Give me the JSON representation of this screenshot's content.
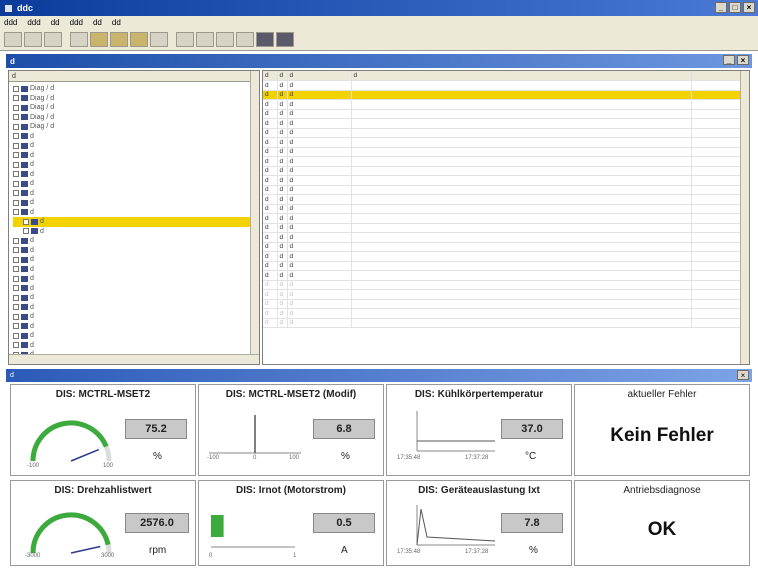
{
  "window": {
    "title": "ddc"
  },
  "menu": [
    "ddd",
    "ddd",
    "dd",
    "ddd",
    "dd",
    "dd"
  ],
  "inner": {
    "title": "d"
  },
  "tree": {
    "header": "d",
    "items": [
      {
        "label": "Diag / d",
        "sel": false
      },
      {
        "label": "Diag / d",
        "sel": false
      },
      {
        "label": "Diag / d",
        "sel": false
      },
      {
        "label": "Diag / d",
        "sel": false
      },
      {
        "label": "Diag / d",
        "sel": false
      },
      {
        "label": "d",
        "sel": false
      },
      {
        "label": "d",
        "sel": false
      },
      {
        "label": "d",
        "sel": false
      },
      {
        "label": "d",
        "sel": false
      },
      {
        "label": "d",
        "sel": false
      },
      {
        "label": "d",
        "sel": false
      },
      {
        "label": "d",
        "sel": false
      },
      {
        "label": "d",
        "sel": false
      },
      {
        "label": "d",
        "sel": false
      },
      {
        "label": "d",
        "sel": true
      },
      {
        "label": "d",
        "sel": false
      },
      {
        "label": "d",
        "sel": false
      },
      {
        "label": "d",
        "sel": false
      },
      {
        "label": "d",
        "sel": false
      },
      {
        "label": "d",
        "sel": false
      },
      {
        "label": "d",
        "sel": false
      },
      {
        "label": "d",
        "sel": false
      },
      {
        "label": "d",
        "sel": false
      },
      {
        "label": "d",
        "sel": false
      },
      {
        "label": "d",
        "sel": false
      },
      {
        "label": "d",
        "sel": false
      },
      {
        "label": "d",
        "sel": false
      },
      {
        "label": "d",
        "sel": false
      },
      {
        "label": "d",
        "sel": false
      }
    ]
  },
  "table": {
    "headers": [
      "d",
      "d",
      "d",
      "d"
    ],
    "rows": [
      {
        "a": "d",
        "b": "d",
        "name": "d",
        "val": "d",
        "sel": false,
        "faded": false
      },
      {
        "a": "d",
        "b": "d",
        "name": "d",
        "val": "d",
        "sel": true,
        "faded": false
      },
      {
        "a": "d",
        "b": "d",
        "name": "d",
        "val": "d",
        "sel": false,
        "faded": false
      },
      {
        "a": "d",
        "b": "d",
        "name": "d",
        "val": "d",
        "sel": false,
        "faded": false
      },
      {
        "a": "d",
        "b": "d",
        "name": "d",
        "val": "d",
        "sel": false,
        "faded": false
      },
      {
        "a": "d",
        "b": "d",
        "name": "d",
        "val": "d",
        "sel": false,
        "faded": false
      },
      {
        "a": "d",
        "b": "d",
        "name": "d",
        "val": "d",
        "sel": false,
        "faded": false
      },
      {
        "a": "d",
        "b": "d",
        "name": "d",
        "val": "d",
        "sel": false,
        "faded": false
      },
      {
        "a": "d",
        "b": "d",
        "name": "d",
        "val": "d",
        "sel": false,
        "faded": false
      },
      {
        "a": "d",
        "b": "d",
        "name": "d",
        "val": "d",
        "sel": false,
        "faded": false
      },
      {
        "a": "d",
        "b": "d",
        "name": "d",
        "val": "d",
        "sel": false,
        "faded": false
      },
      {
        "a": "d",
        "b": "d",
        "name": "d",
        "val": "d",
        "sel": false,
        "faded": false
      },
      {
        "a": "d",
        "b": "d",
        "name": "d",
        "val": "d",
        "sel": false,
        "faded": false
      },
      {
        "a": "d",
        "b": "d",
        "name": "d",
        "val": "d",
        "sel": false,
        "faded": false
      },
      {
        "a": "d",
        "b": "d",
        "name": "d",
        "val": "d",
        "sel": false,
        "faded": false
      },
      {
        "a": "d",
        "b": "d",
        "name": "d",
        "val": "d",
        "sel": false,
        "faded": false
      },
      {
        "a": "d",
        "b": "d",
        "name": "d",
        "val": "d",
        "sel": false,
        "faded": false
      },
      {
        "a": "d",
        "b": "d",
        "name": "d",
        "val": "d",
        "sel": false,
        "faded": false
      },
      {
        "a": "d",
        "b": "d",
        "name": "d",
        "val": "d",
        "sel": false,
        "faded": false
      },
      {
        "a": "d",
        "b": "d",
        "name": "d",
        "val": "d",
        "sel": false,
        "faded": false
      },
      {
        "a": "d",
        "b": "d",
        "name": "d",
        "val": "d",
        "sel": false,
        "faded": false
      },
      {
        "a": "d",
        "b": "d",
        "name": "d",
        "val": "d",
        "sel": false,
        "faded": true
      },
      {
        "a": "d",
        "b": "d",
        "name": "d",
        "val": "d",
        "sel": false,
        "faded": true
      },
      {
        "a": "d",
        "b": "d",
        "name": "d",
        "val": "d",
        "sel": false,
        "faded": true
      },
      {
        "a": "d",
        "b": "d",
        "name": "d",
        "val": "d",
        "sel": false,
        "faded": true
      },
      {
        "a": "d",
        "b": "d",
        "name": "d",
        "val": "d",
        "sel": false,
        "faded": true
      }
    ]
  },
  "panel": {
    "title": "d"
  },
  "gauges": {
    "g1": {
      "title": "DIS: MCTRL-MSET2",
      "value": "75.2",
      "unit": "%",
      "min": "-100",
      "max": "100",
      "level": 0.876,
      "color": "#3caa3c"
    },
    "g2": {
      "title": "DIS: MCTRL-MSET2 (Modif)",
      "value": "6.8",
      "unit": "%",
      "ticks": [
        "-100",
        "0",
        "100"
      ]
    },
    "g3": {
      "title": "DIS: Kühlkörpertemperatur",
      "value": "37.0",
      "unit": "°C",
      "t0": "17:35:48",
      "t1": "17:37:28"
    },
    "g4": {
      "title": "aktueller Fehler",
      "value": "Kein Fehler"
    },
    "g5": {
      "title": "DIS: Drehzahlistwert",
      "value": "2576.0",
      "unit": "rpm",
      "min": "-3000",
      "max": "3000",
      "level": 0.93,
      "color": "#3caa3c"
    },
    "g6": {
      "title": "DIS: Irnot (Motorstrom)",
      "value": "0.5",
      "unit": "A",
      "ticks": [
        "0",
        "1"
      ],
      "level": 0.5,
      "color": "#3caa3c"
    },
    "g7": {
      "title": "DIS: Geräteauslastung Ixt",
      "value": "7.8",
      "unit": "%",
      "t0": "17:35:48",
      "t1": "17:37:28"
    },
    "g8": {
      "title": "Antriebsdiagnose",
      "value": "OK"
    }
  }
}
